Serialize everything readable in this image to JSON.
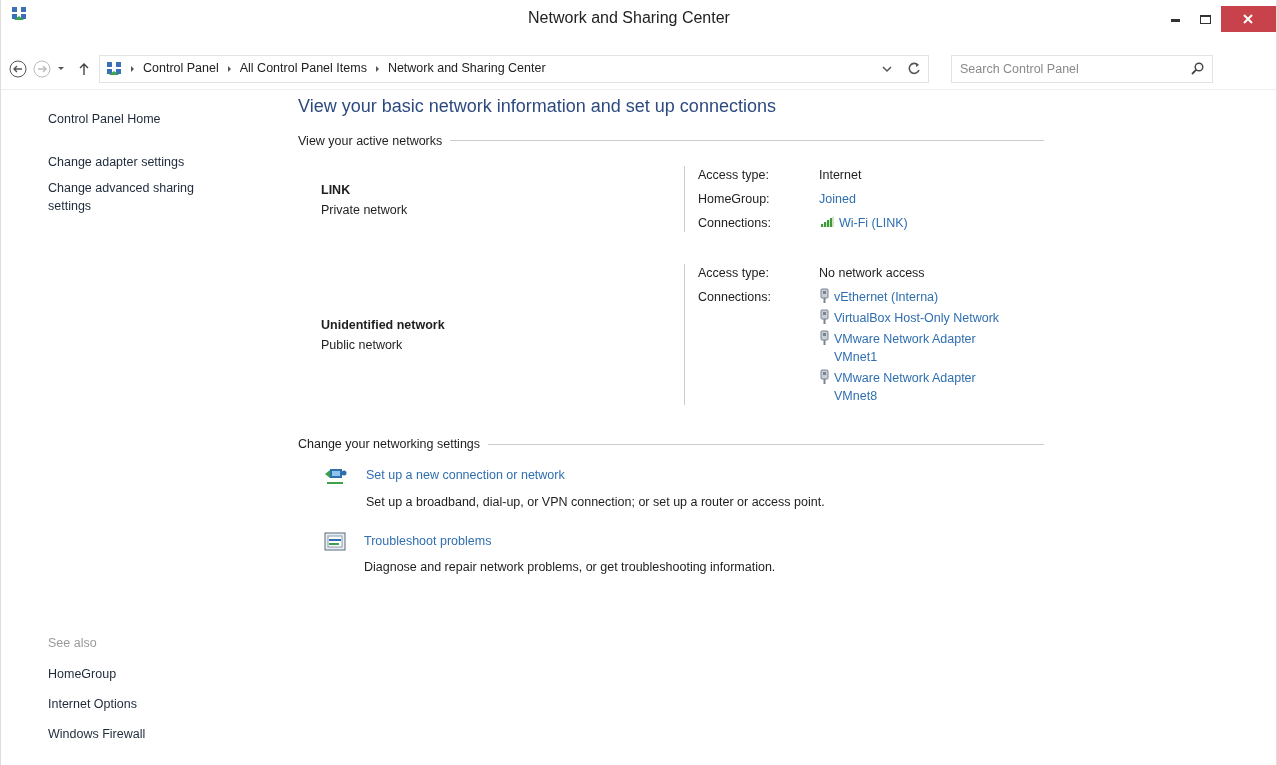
{
  "window": {
    "title": "Network and Sharing Center"
  },
  "address_bar": {
    "breadcrumbs": [
      "Control Panel",
      "All Control Panel Items",
      "Network and Sharing Center"
    ]
  },
  "search": {
    "placeholder": "Search Control Panel"
  },
  "sidebar": {
    "items": [
      {
        "label": "Control Panel Home",
        "kind": "home"
      },
      {
        "label": "Change adapter settings",
        "kind": "task"
      },
      {
        "label": "Change advanced sharing settings",
        "kind": "task"
      }
    ],
    "see_also": {
      "heading": "See also",
      "items": [
        "HomeGroup",
        "Internet Options",
        "Windows Firewall"
      ]
    }
  },
  "heading": "View your basic network information and set up connections",
  "active_networks": {
    "title": "View your active networks",
    "networks": [
      {
        "name": "LINK",
        "category": "Private network",
        "details": [
          {
            "label": "Access type:",
            "values": [
              {
                "text": "Internet",
                "kind": "plain"
              }
            ]
          },
          {
            "label": "HomeGroup:",
            "values": [
              {
                "text": "Joined",
                "kind": "link"
              }
            ]
          },
          {
            "label": "Connections:",
            "values": [
              {
                "text": "Wi-Fi (LINK)",
                "kind": "wifi"
              }
            ]
          }
        ]
      },
      {
        "name": "Unidentified network",
        "category": "Public network",
        "details": [
          {
            "label": "Access type:",
            "values": [
              {
                "text": "No network access",
                "kind": "plain"
              }
            ]
          },
          {
            "label": "Connections:",
            "values": [
              {
                "text": "vEthernet (Interna)",
                "kind": "wired"
              },
              {
                "text": "VirtualBox Host-Only Network",
                "kind": "wired"
              },
              {
                "text": "VMware Network Adapter VMnet1",
                "kind": "wired"
              },
              {
                "text": "VMware Network Adapter VMnet8",
                "kind": "wired"
              }
            ]
          }
        ]
      }
    ]
  },
  "networking_settings": {
    "title": "Change your networking settings",
    "tasks": [
      {
        "link": "Set up a new connection or network",
        "description": "Set up a broadband, dial-up, or VPN connection; or set up a router or access point.",
        "kind": "setup"
      },
      {
        "link": "Troubleshoot problems",
        "description": "Diagnose and repair network problems, or get troubleshooting information.",
        "kind": "troubleshoot"
      }
    ]
  }
}
